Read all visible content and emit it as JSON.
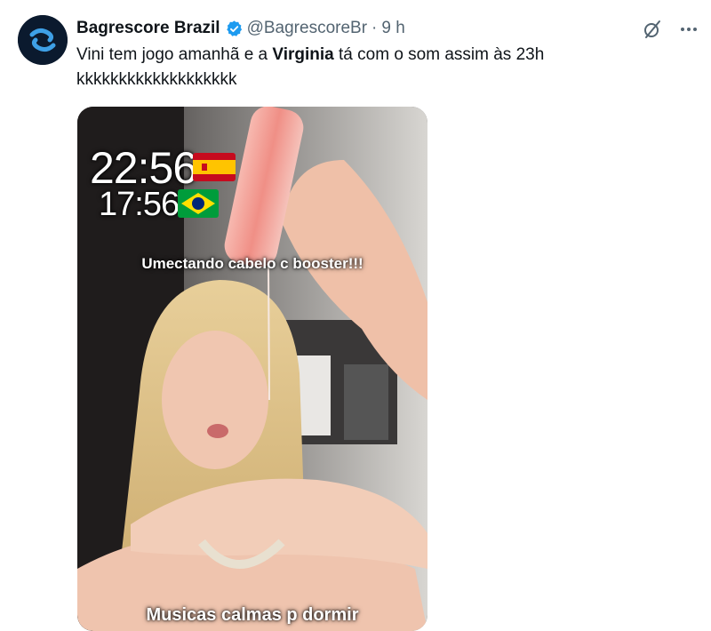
{
  "author": {
    "display_name": "Bagrescore Brazil",
    "handle": "@BagrescoreBr",
    "separator": "·",
    "time": "9 h"
  },
  "tweet": {
    "text_part1": "Vini tem jogo amanhã e a ",
    "text_bold": "Virginia",
    "text_part2": " tá com o som assim às 23h",
    "text_line2": "kkkkkkkkkkkkkkkkkkk"
  },
  "media": {
    "clock_main": "22:56",
    "clock_sub": "17:56",
    "caption_top": "Umectando cabelo c booster!!!",
    "caption_bottom": "Musicas calmas p dormir"
  },
  "icons": {
    "verified": "verified-badge-icon",
    "grok": "grok-icon",
    "more": "more-options-icon"
  },
  "colors": {
    "verified": "#1d9bf0",
    "secondary_text": "#536471",
    "primary_text": "#0f1419"
  }
}
